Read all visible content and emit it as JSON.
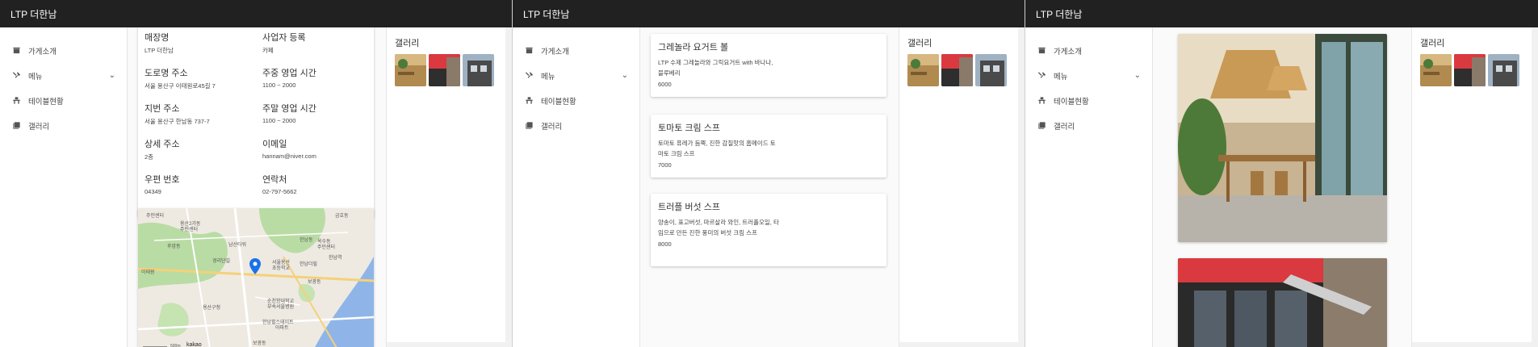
{
  "app_title": "LTP 더한남",
  "nav": {
    "intro": "가게소개",
    "menu": "메뉴",
    "tables": "테이블현황",
    "gallery": "갤러리"
  },
  "gallery_title": "갤러리",
  "store_info": {
    "store_name_label": "매장명",
    "store_name": "LTP 더한남",
    "biz_label": "사업자 등록",
    "biz_value": "카페",
    "road_label": "도로명 주소",
    "road_value": "서울 용산구 이태원로45길 7",
    "weekday_label": "주중 영업 시간",
    "weekday_value": "1100 ~ 2000",
    "jibun_label": "지번 주소",
    "jibun_value": "서울 용산구 한남동 737-7",
    "weekend_label": "주말 영업 시간",
    "weekend_value": "1100 ~ 2000",
    "detail_label": "상세 주소",
    "detail_value": "2층",
    "email_label": "이메일",
    "email_value": "hannam@niver.com",
    "zip_label": "우편 번호",
    "zip_value": "04349",
    "phone_label": "연락처",
    "phone_value": "02-797-5662"
  },
  "map": {
    "labels": [
      "주민센터",
      "용산2가동",
      "주민센터",
      "남산타워",
      "후암동",
      "경리단길",
      "한남동",
      "서울용산",
      "초등학교",
      "한남더힐",
      "옥수동",
      "주민센터",
      "한남역",
      "이태원",
      "보광동",
      "순천향대학교",
      "부속서울병원",
      "용산구청",
      "한남힐스테이트",
      "아파트",
      "보광동",
      "금호동"
    ],
    "scale": "500m",
    "brand": "kakao"
  },
  "menu_items": [
    {
      "name": "그레놀라 요거트 볼",
      "desc": "LTP 수제 그레놀라와 그릭요거트 with 바나나, 블루베리",
      "price": "6000"
    },
    {
      "name": "토마토 크림 스프",
      "desc": "토마토 퓨레가 듬뿍, 진한 감칠맛의 홈메이드 토마토 크림 스프",
      "price": "7000"
    },
    {
      "name": "트러플 버섯 스프",
      "desc": "양송이, 표고버섯, 마르살라 와인, 트러플오일, 타임으로 만든 진한 풍미의 버섯 크림 스프",
      "price": "8000"
    }
  ],
  "colors": {
    "appbar": "#212121",
    "map_pin": "#1a73e8",
    "accent_red": "#d9393f"
  },
  "icons": [
    "store-icon",
    "utensils-icon",
    "table-icon",
    "gallery-icon",
    "chevron-down-icon"
  ]
}
